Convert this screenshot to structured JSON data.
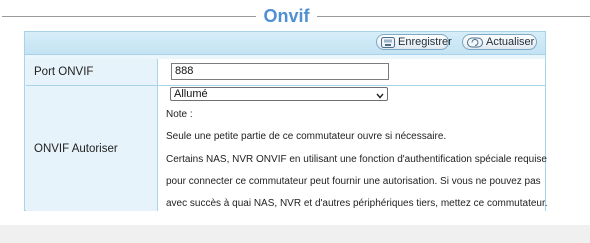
{
  "header": {
    "title": "Onvif"
  },
  "toolbar": {
    "save_label": "Enregistrer",
    "refresh_label": "Actualiser"
  },
  "port": {
    "label": "Port ONVIF",
    "value": "888"
  },
  "auth": {
    "label": "ONVIF Autoriser",
    "selected": "Allumé",
    "note_title": "Note :",
    "lines": [
      "Seule une petite partie de ce commutateur ouvre si nécessaire.",
      "Certains NAS, NVR ONVIF en utilisant une fonction d'authentification spéciale requise",
      "pour connecter ce commutateur peut fournir une autorisation. Si vous ne pouvez pas",
      "avec succès à quai NAS, NVR et d'autres périphériques tiers, mettez ce commutateur."
    ]
  },
  "colors": {
    "title": "#4f8fd3",
    "toolbar": "#c8e6f5",
    "panel_border": "#a9d3ea"
  },
  "icons": {
    "save": "save-icon",
    "refresh": "refresh-icon",
    "dropdown": "chevron-down-icon"
  }
}
